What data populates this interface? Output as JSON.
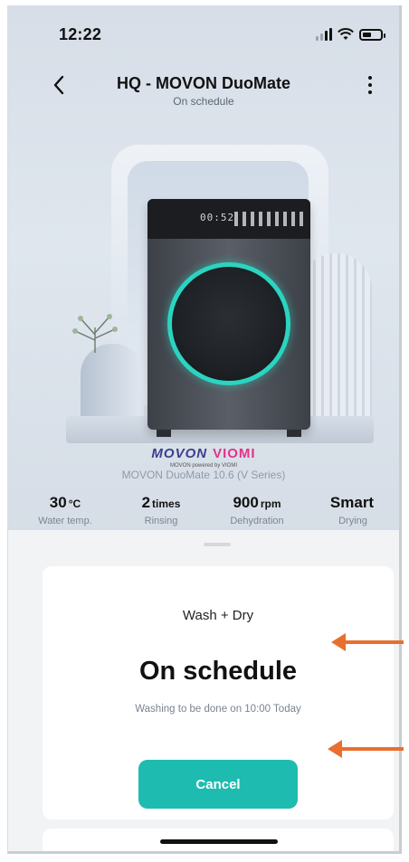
{
  "status_bar": {
    "time": "12:22"
  },
  "header": {
    "title": "HQ - MOVON DuoMate",
    "subtitle": "On schedule"
  },
  "product": {
    "brand": "MOVON",
    "partner": "VIOMI",
    "powered_by": "MOVON powered by VIOMI",
    "model": "MOVON DuoMate 10.6 (V Series)",
    "display_reading": "00:52"
  },
  "stats": [
    {
      "value": "30",
      "unit": "°C",
      "label": "Water temp."
    },
    {
      "value": "2",
      "unit": "times",
      "label": "Rinsing"
    },
    {
      "value": "900",
      "unit": "rpm",
      "label": "Dehydration"
    },
    {
      "value": "Smart",
      "unit": "",
      "label": "Drying"
    }
  ],
  "card": {
    "mode": "Wash + Dry",
    "state": "On schedule",
    "note": "Washing to be done on 10:00 Today",
    "cancel_label": "Cancel"
  },
  "colors": {
    "accent": "#1ebcb0",
    "ring": "#2bd4c0",
    "annotation": "#e86f2f"
  }
}
